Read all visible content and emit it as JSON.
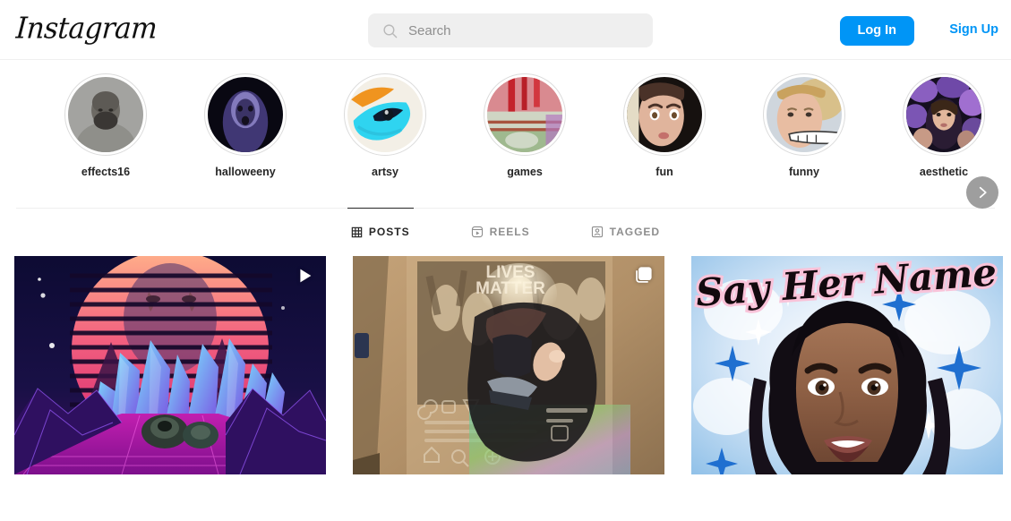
{
  "header": {
    "logo_text": "Instagram",
    "search": {
      "placeholder": "Search",
      "value": ""
    },
    "login_label": "Log In",
    "signup_label": "Sign Up",
    "accent_color": "#0095f6"
  },
  "highlights": {
    "next_button_label": "Next",
    "items": [
      {
        "label": "effects16",
        "theme": "grayscale-portrait"
      },
      {
        "label": "halloweeny",
        "theme": "dark-purple-ghost"
      },
      {
        "label": "artsy",
        "theme": "cyan-orange-eye"
      },
      {
        "label": "games",
        "theme": "pink-interior"
      },
      {
        "label": "fun",
        "theme": "cartoon-face"
      },
      {
        "label": "funny",
        "theme": "face-hand-overlay"
      },
      {
        "label": "aesthetic",
        "theme": "purple-flowers-portrait"
      }
    ]
  },
  "tabs": [
    {
      "label": "POSTS",
      "icon": "grid-icon",
      "active": true
    },
    {
      "label": "REELS",
      "icon": "reels-icon",
      "active": false
    },
    {
      "label": "TAGGED",
      "icon": "tagged-icon",
      "active": false
    }
  ],
  "posts": [
    {
      "type": "video",
      "badge": "play-icon",
      "caption": "vaporwave retro sunset crystals"
    },
    {
      "type": "carousel",
      "badge": "carousel-icon",
      "caption": "BLACK LIVES MATTER projection AR"
    },
    {
      "type": "image",
      "badge": "",
      "caption": "Say Her Name airbrush portrait"
    }
  ]
}
